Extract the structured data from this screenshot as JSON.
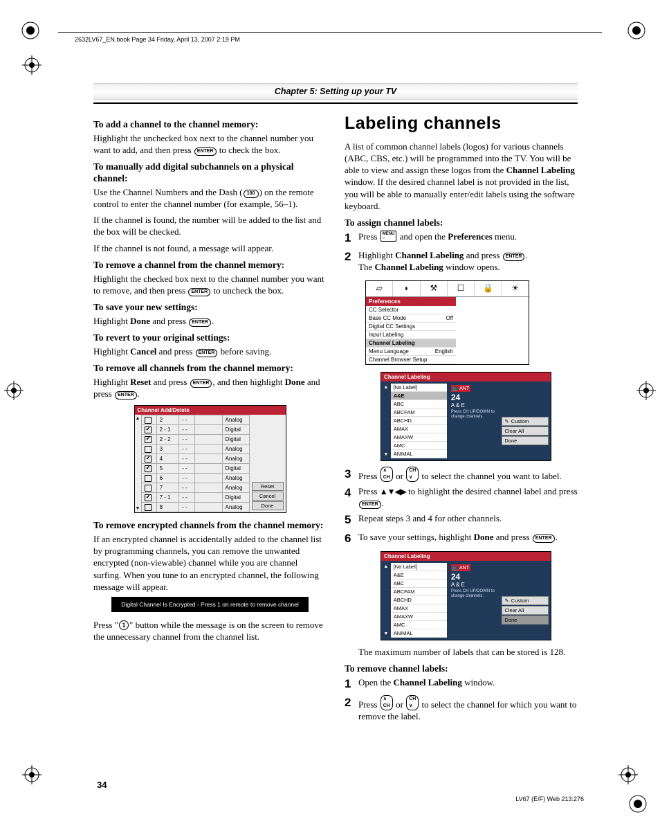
{
  "header": {
    "runningHead": "2632LV67_EN.book  Page 34  Friday, April 13, 2007  2:19 PM",
    "chapter": "Chapter 5: Setting up your TV"
  },
  "left": {
    "s1": {
      "head": "To add a channel to the channel memory:",
      "body": "Highlight the unchecked box next to the channel number you want to add, and then press ",
      "body2": " to check the box."
    },
    "s2": {
      "head": "To manually add digital subchannels on a physical channel:",
      "p1a": "Use the Channel Numbers and the Dash (",
      "p1b": ") on the remote control to enter the channel number (for example, 56–1).",
      "p2": "If the channel is found, the number will be added to the list and the box will be checked.",
      "p3": "If the channel is not found, a message will appear."
    },
    "s3": {
      "head": "To remove a channel from the channel memory:",
      "body": "Highlight the checked box next to the channel number you want to remove, and then press ",
      "body2": " to uncheck the box."
    },
    "s4": {
      "head": "To save your new settings:",
      "p1": "Highlight ",
      "p2": " and press ",
      "done": "Done"
    },
    "s5": {
      "head": "To revert to your original settings:",
      "p1": "Highlight ",
      "p2": " and press ",
      "p3": " before saving.",
      "cancel": "Cancel"
    },
    "s6": {
      "head": "To remove all channels from the channel memory:",
      "p1": "Highlight ",
      "p2": " and press ",
      "p3": ", and then highlight ",
      "p4": " and press ",
      "reset": "Reset",
      "done": "Done"
    },
    "addDelete": {
      "title": "Channel Add/Delete",
      "rows": [
        {
          "checked": false,
          "ch": "2",
          "type": "Analog"
        },
        {
          "checked": true,
          "ch": "2 - 1",
          "type": "Digital"
        },
        {
          "checked": true,
          "ch": "2 - 2",
          "type": "Digital"
        },
        {
          "checked": false,
          "ch": "3",
          "type": "Analog"
        },
        {
          "checked": true,
          "ch": "4",
          "type": "Analog"
        },
        {
          "checked": true,
          "ch": "5",
          "type": "Digital"
        },
        {
          "checked": false,
          "ch": "6",
          "type": "Analog"
        },
        {
          "checked": false,
          "ch": "7",
          "type": "Analog"
        },
        {
          "checked": true,
          "ch": "7 - 1",
          "type": "Digital"
        },
        {
          "checked": false,
          "ch": "8",
          "type": "Analog"
        }
      ],
      "buttons": {
        "reset": "Reset",
        "cancel": "Cancel",
        "done": "Done"
      }
    },
    "s7": {
      "head": "To remove encrypted channels from the channel memory:",
      "body": "If an encrypted channel is accidentally added to the channel list by programming channels, you can remove the unwanted encrypted (non-viewable) channel while you are channel surfing. When you tune to an encrypted channel, the following message will appear."
    },
    "encryptedMsg": "Digital Channel Is Encrypted - Press 1 on remote to remove channel",
    "s7b": {
      "p1": "Press \"",
      "p2": "\" button while the message is on the screen to remove the unnecessary channel from the channel list."
    }
  },
  "right": {
    "title": "Labeling channels",
    "intro": {
      "p1": "A list of common channel labels (logos) for various channels (ABC, CBS, etc.) will be programmed into the TV. You will be able to view and assign these logos from the ",
      "p2": " window. If the desired channel label is not provided in the list, you will be able to manually enter/edit labels using the software keyboard.",
      "bold": "Channel Labeling"
    },
    "assign": {
      "head": "To assign channel labels:",
      "step1": {
        "a": "Press ",
        "b": " and open the ",
        "c": " menu.",
        "pref": "Preferences"
      },
      "step2": {
        "a": "Highlight ",
        "b": " and press ",
        "c": ".",
        "cl": "Channel Labeling",
        "d": "The ",
        "e": " window opens."
      },
      "step3": {
        "a": "Press ",
        "b": " or ",
        "c": " to select the channel you want to label."
      },
      "step4": {
        "a": "Press ",
        "b": " to highlight the desired channel label and press ",
        "c": "."
      },
      "step5": "Repeat steps 3 and 4 for other channels.",
      "step6": {
        "a": "To save your settings, highlight ",
        "b": " and press ",
        "c": ".",
        "done": "Done"
      }
    },
    "prefsMenu": {
      "header": "Preferences",
      "items": [
        {
          "label": "CC Selector",
          "val": ""
        },
        {
          "label": "Base CC Mode",
          "val": "Off"
        },
        {
          "label": "Digital CC Settings",
          "val": ""
        },
        {
          "label": "Input Labeling",
          "val": ""
        },
        {
          "label": "Channel Labeling",
          "val": "",
          "sel": true
        },
        {
          "label": "Menu Language",
          "val": "English"
        },
        {
          "label": "Channel Browser Setup",
          "val": ""
        }
      ]
    },
    "clMenu1": {
      "title": "Channel Labeling",
      "list": [
        "[No Label]",
        "A&E",
        "ABC",
        "ABCFAM",
        "ABCHD",
        "AMAX",
        "AMAXW",
        "AMC",
        "ANIMAL"
      ],
      "selected": "A&E",
      "ant": "ANT",
      "chNum": "24",
      "chLabel": "A & E",
      "hint": "Press CH UP/DOWN to change channels.",
      "btns": {
        "custom": "Custom",
        "clear": "Clear All",
        "done": "Done"
      },
      "selectedBtn": ""
    },
    "clMenu2": {
      "title": "Channel Labeling",
      "list": [
        "[No Label]",
        "A&E",
        "ABC",
        "ABCFAM",
        "ABCHD",
        "AMAX",
        "AMAXW",
        "AMC",
        "ANIMAL"
      ],
      "selected": "",
      "ant": "ANT",
      "chNum": "24",
      "chLabel": "A & E",
      "hint": "Press CH UP/DOWN to change channels.",
      "btns": {
        "custom": "Custom",
        "clear": "Clear All",
        "done": "Done"
      },
      "selectedBtn": "Done"
    },
    "maxNote": "The maximum number of labels that can be stored is 128.",
    "remove": {
      "head": "To remove channel labels:",
      "step1": {
        "a": "Open the ",
        "b": " window.",
        "cl": "Channel Labeling"
      },
      "step2": {
        "a": "Press ",
        "b": " or ",
        "c": " to select the channel for which you want to remove the label."
      }
    }
  },
  "footer": {
    "pageNum": "34",
    "tag": "LV67 (E/F) Web 213:276"
  },
  "icons": {
    "enter": "ENTER",
    "menu": "MENU",
    "dash": "100",
    "ch": "CH"
  }
}
